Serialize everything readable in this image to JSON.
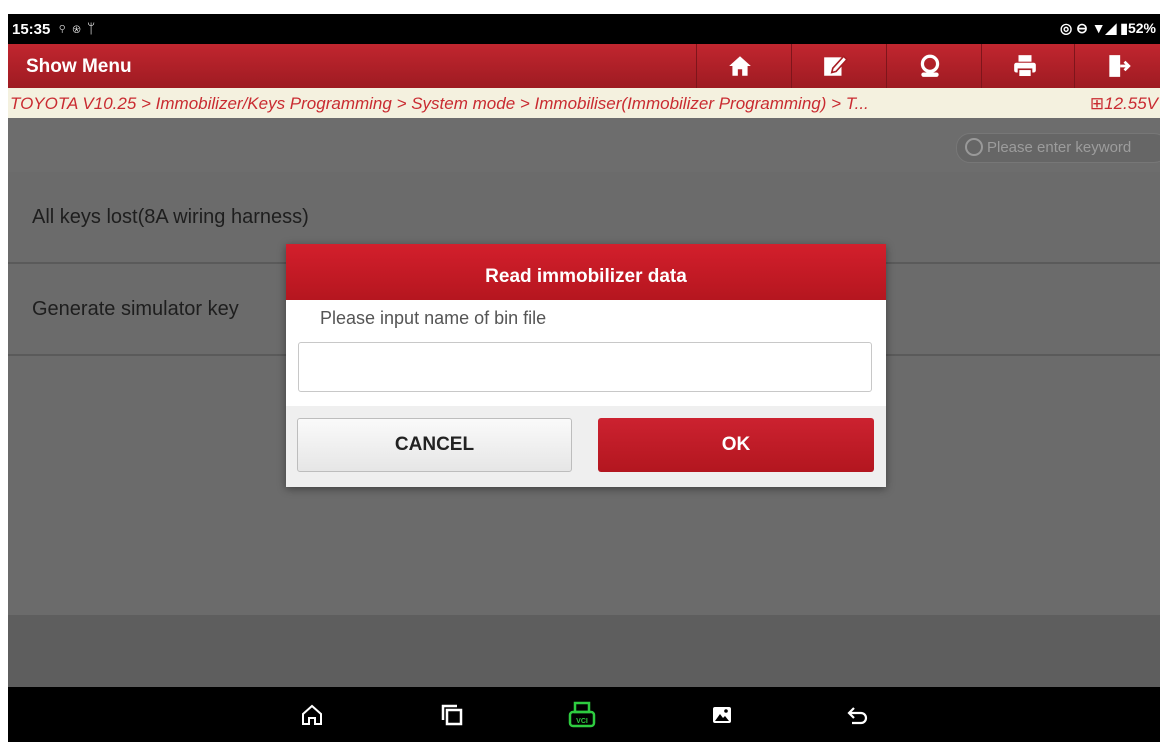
{
  "status_bar": {
    "time": "15:35",
    "left_icons": [
      "location-icon",
      "bluetooth-icon",
      "usb-icon"
    ],
    "right_icons": [
      "location-icon",
      "do-not-disturb-icon",
      "wifi-icon",
      "signal-icon",
      "battery-icon"
    ],
    "battery": "52%"
  },
  "header": {
    "title": "Show Menu",
    "buttons": [
      "home-icon",
      "edit-report-icon",
      "support-icon",
      "print-icon",
      "exit-icon"
    ]
  },
  "breadcrumb": {
    "path": "TOYOTA V10.25 > Immobilizer/Keys Programming > System mode > Immobiliser(Immobilizer Programming) > T...",
    "voltage": "12.55V"
  },
  "search": {
    "placeholder": "Please enter keyword"
  },
  "menu": {
    "items": [
      {
        "label": "All keys lost(8A wiring harness)"
      },
      {
        "label": "Generate simulator key"
      }
    ]
  },
  "dialog": {
    "title": "Read immobilizer data",
    "prompt": "Please input name of bin file",
    "input_value": "",
    "cancel_label": "CANCEL",
    "ok_label": "OK"
  },
  "nav_bar": {
    "buttons": [
      "home-icon",
      "recent-apps-icon",
      "vci-icon",
      "screenshot-icon",
      "back-icon"
    ],
    "vci_label": "VCI"
  },
  "colors": {
    "accent_red": "#b5161f",
    "breadcrumb_text": "#c92b31",
    "vci_green": "#2ecc40"
  }
}
